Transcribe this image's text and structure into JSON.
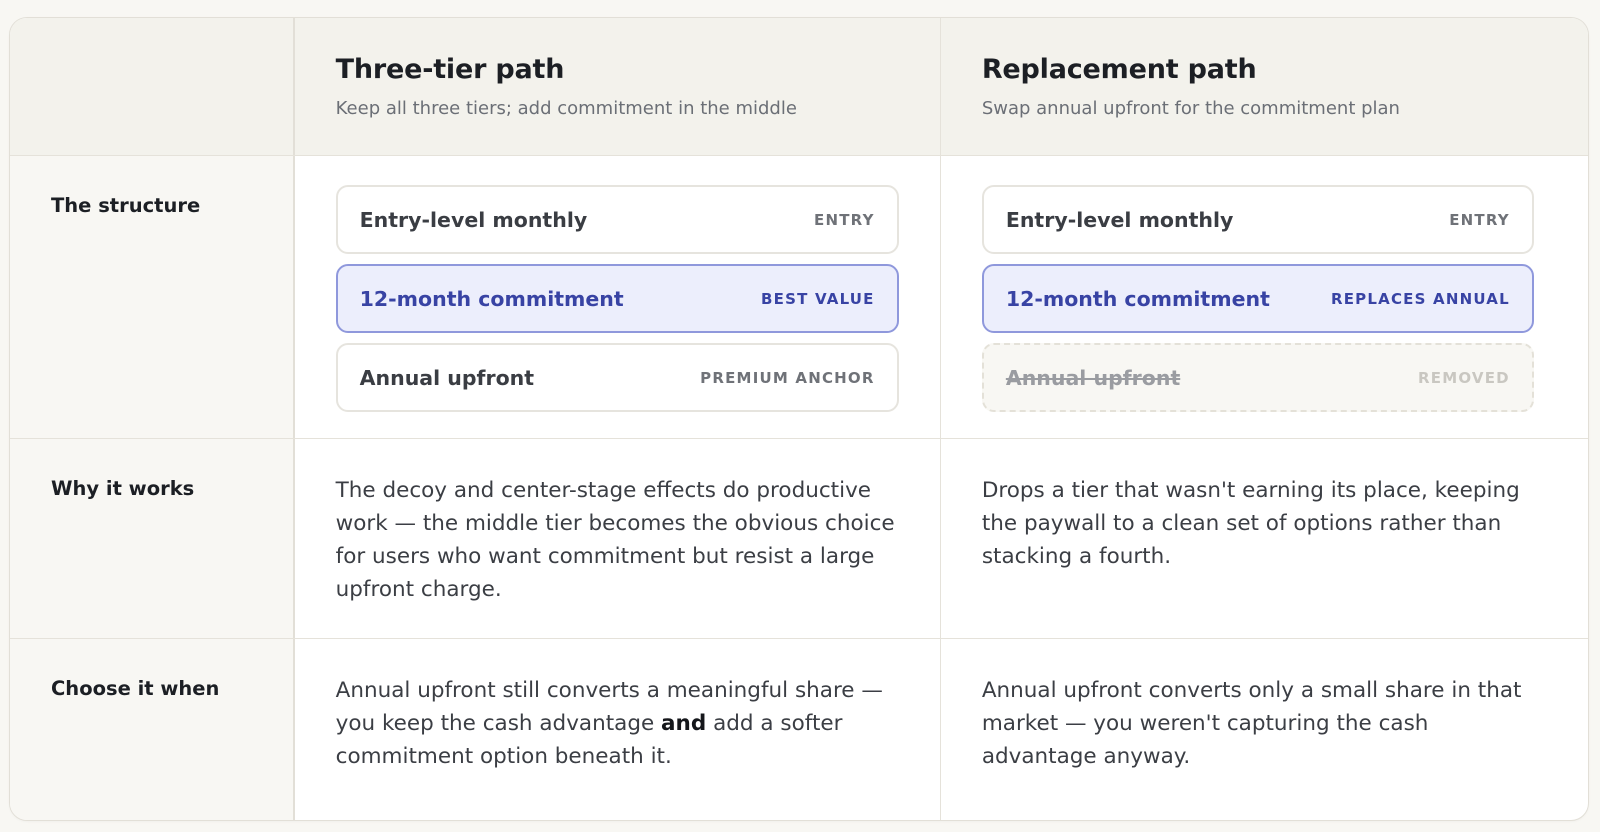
{
  "columns": [
    {
      "title": "Three-tier path",
      "subtitle": "Keep all three tiers; add commitment in the middle"
    },
    {
      "title": "Replacement path",
      "subtitle": "Swap annual upfront for the commitment plan"
    }
  ],
  "rows": {
    "structure_label": "The structure",
    "why_label": "Why it works",
    "choose_label": "Choose it when"
  },
  "three_tier": {
    "tiers": [
      {
        "name": "Entry-level monthly",
        "badge": "ENTRY"
      },
      {
        "name": "12-month commitment",
        "badge": "BEST VALUE"
      },
      {
        "name": "Annual upfront",
        "badge": "PREMIUM ANCHOR"
      }
    ],
    "why": "The decoy and center-stage effects do productive work — the middle tier becomes the obvious choice for users who want commitment but resist a large upfront charge.",
    "choose_before": "Annual upfront still converts a meaningful share — you keep the cash advantage ",
    "choose_bold": "and",
    "choose_after": " add a softer commitment option beneath it."
  },
  "replacement": {
    "tiers": [
      {
        "name": "Entry-level monthly",
        "badge": "ENTRY"
      },
      {
        "name": "12-month commitment",
        "badge": "REPLACES ANNUAL"
      },
      {
        "name": "Annual upfront",
        "badge": "REMOVED"
      }
    ],
    "why": "Drops a tier that wasn't earning its place, keeping the paywall to a clean set of options rather than stacking a fourth.",
    "choose": "Annual upfront converts only a small share in that market — you weren't capturing the cash advantage anyway."
  },
  "colors": {
    "highlight_bg": "#eceefc",
    "highlight_border": "#8f98dc",
    "highlight_text": "#3843a4"
  }
}
